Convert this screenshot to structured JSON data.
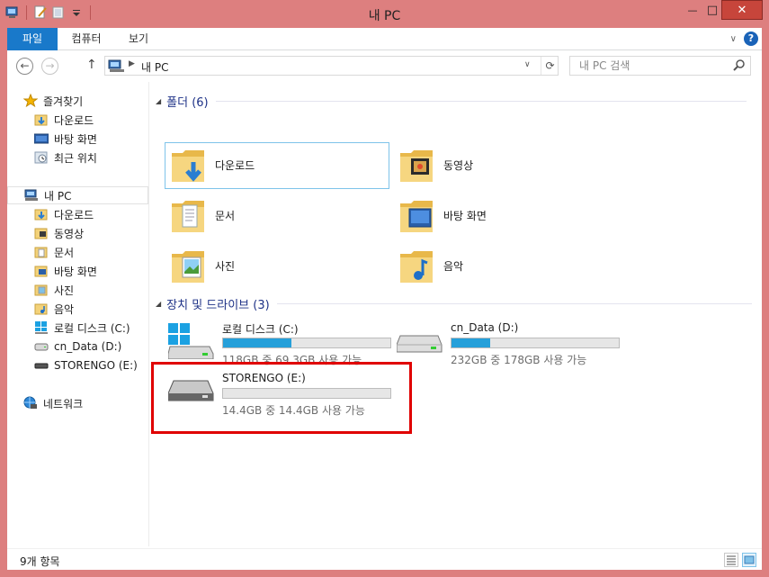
{
  "window": {
    "title": "내 PC",
    "controls": {
      "minimize": "—",
      "maximize": "□",
      "close": "✕"
    }
  },
  "ribbon": {
    "tabs": [
      {
        "label": "파일"
      },
      {
        "label": "컴퓨터"
      },
      {
        "label": "보기"
      }
    ],
    "help": "?"
  },
  "address": {
    "path": "내 PC",
    "search_placeholder": "내 PC 검색"
  },
  "navpane": {
    "favorites": {
      "label": "즐겨찾기",
      "items": [
        {
          "label": "다운로드"
        },
        {
          "label": "바탕 화면"
        },
        {
          "label": "최근 위치"
        }
      ]
    },
    "thispc": {
      "label": "내 PC",
      "items": [
        {
          "label": "다운로드"
        },
        {
          "label": "동영상"
        },
        {
          "label": "문서"
        },
        {
          "label": "바탕 화면"
        },
        {
          "label": "사진"
        },
        {
          "label": "음악"
        },
        {
          "label": "로컬 디스크 (C:)"
        },
        {
          "label": "cn_Data (D:)"
        },
        {
          "label": "STORENGO (E:)"
        }
      ]
    },
    "network": {
      "label": "네트워크"
    }
  },
  "content": {
    "folders_header": "폴더 (6)",
    "folders": [
      {
        "label": "다운로드",
        "icon": "download-overlay"
      },
      {
        "label": "동영상",
        "icon": "film-overlay"
      },
      {
        "label": "문서",
        "icon": "document-overlay"
      },
      {
        "label": "바탕 화면",
        "icon": "desktop-overlay"
      },
      {
        "label": "사진",
        "icon": "picture-overlay"
      },
      {
        "label": "음악",
        "icon": "music-overlay"
      }
    ],
    "drives_header": "장치 및 드라이브 (3)",
    "drives": [
      {
        "name": "로컬 디스크 (C:)",
        "space": "118GB 중 69.3GB 사용 가능",
        "used_fraction": 0.41
      },
      {
        "name": "cn_Data (D:)",
        "space": "232GB 중 178GB 사용 가능",
        "used_fraction": 0.23
      },
      {
        "name": "STORENGO (E:)",
        "space": "14.4GB 중 14.4GB 사용 가능",
        "used_fraction": 0.0
      }
    ]
  },
  "status": {
    "count": "9개 항목"
  },
  "colors": {
    "accent": "#1979ca",
    "frame": "#dd7f7f",
    "bar_fill": "#26a0da",
    "highlight": "#e00000"
  }
}
